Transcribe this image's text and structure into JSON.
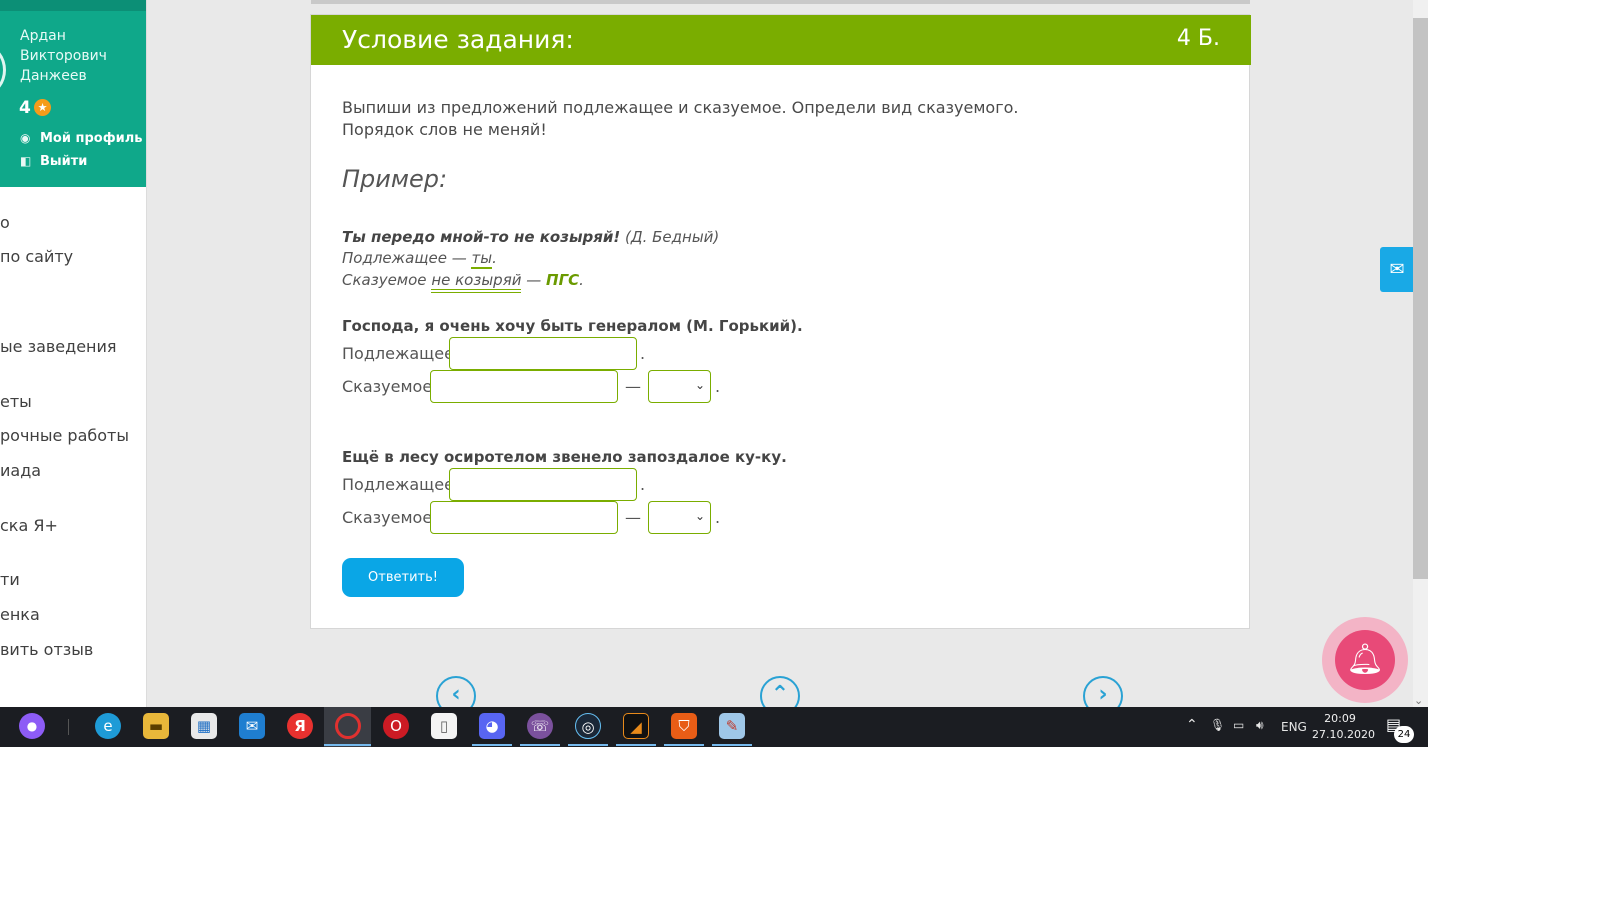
{
  "sidebar": {
    "user_name_lines": [
      "Ардан",
      "Викторович",
      "Данжеев"
    ],
    "rating": "4",
    "profile_link": "Мой профиль",
    "logout_link": "Выйти",
    "menu_items": [
      "о",
      "по сайту",
      "ые заведения",
      "еты",
      "рочные работы",
      "иада",
      "ска Я+",
      "ти",
      "енка",
      "вить отзыв"
    ]
  },
  "task": {
    "header_title": "Условие задания:",
    "points": "4 Б.",
    "instruction_line1": "Выпиши из предложений подлежащее и сказуемое. Определи вид сказуемого.",
    "instruction_line2": "Порядок слов не меняй!",
    "example_title": "Пример:",
    "example": {
      "sentence": "Ты передо мной-то не козыряй!",
      "author": "(Д. Бедный)",
      "subject_prefix": "Подлежащее —",
      "subject_value": "ты",
      "predicate_prefix": "Сказуемое",
      "predicate_value": "не козыряй",
      "predicate_dash": "—",
      "predicate_type": "ПГС"
    },
    "questions": [
      {
        "sentence": "Господа, я очень хочу быть генералом (М. Горький).",
        "subject_label": "Подлежащее",
        "subject_value": "",
        "predicate_label": "Сказуемое",
        "predicate_value": "",
        "type_value": ""
      },
      {
        "sentence": "Ещё в лесу осиротелом звенело запоздалое ку-ку.",
        "subject_label": "Подлежащее",
        "subject_value": "",
        "predicate_label": "Сказуемое",
        "predicate_value": "",
        "type_value": ""
      }
    ],
    "submit_label": "Ответить!"
  },
  "taskbar": {
    "language": "ENG",
    "time": "20:09",
    "date": "27.10.2020",
    "notification_count": "24",
    "apps": [
      "cortana-icon",
      "edge-icon",
      "explorer-icon",
      "store-icon",
      "mail-icon",
      "yandex-icon",
      "opera-gx-icon",
      "opera-icon",
      "file-icon",
      "discord-icon",
      "viber-icon",
      "steam-icon",
      "app-dark-icon",
      "shield-app-icon",
      "paint-icon"
    ]
  },
  "colors": {
    "accent_green": "#7aad00",
    "sidebar_teal": "#0fa88a",
    "button_blue": "#0aa6e6",
    "bell_pink": "#e84a78"
  }
}
